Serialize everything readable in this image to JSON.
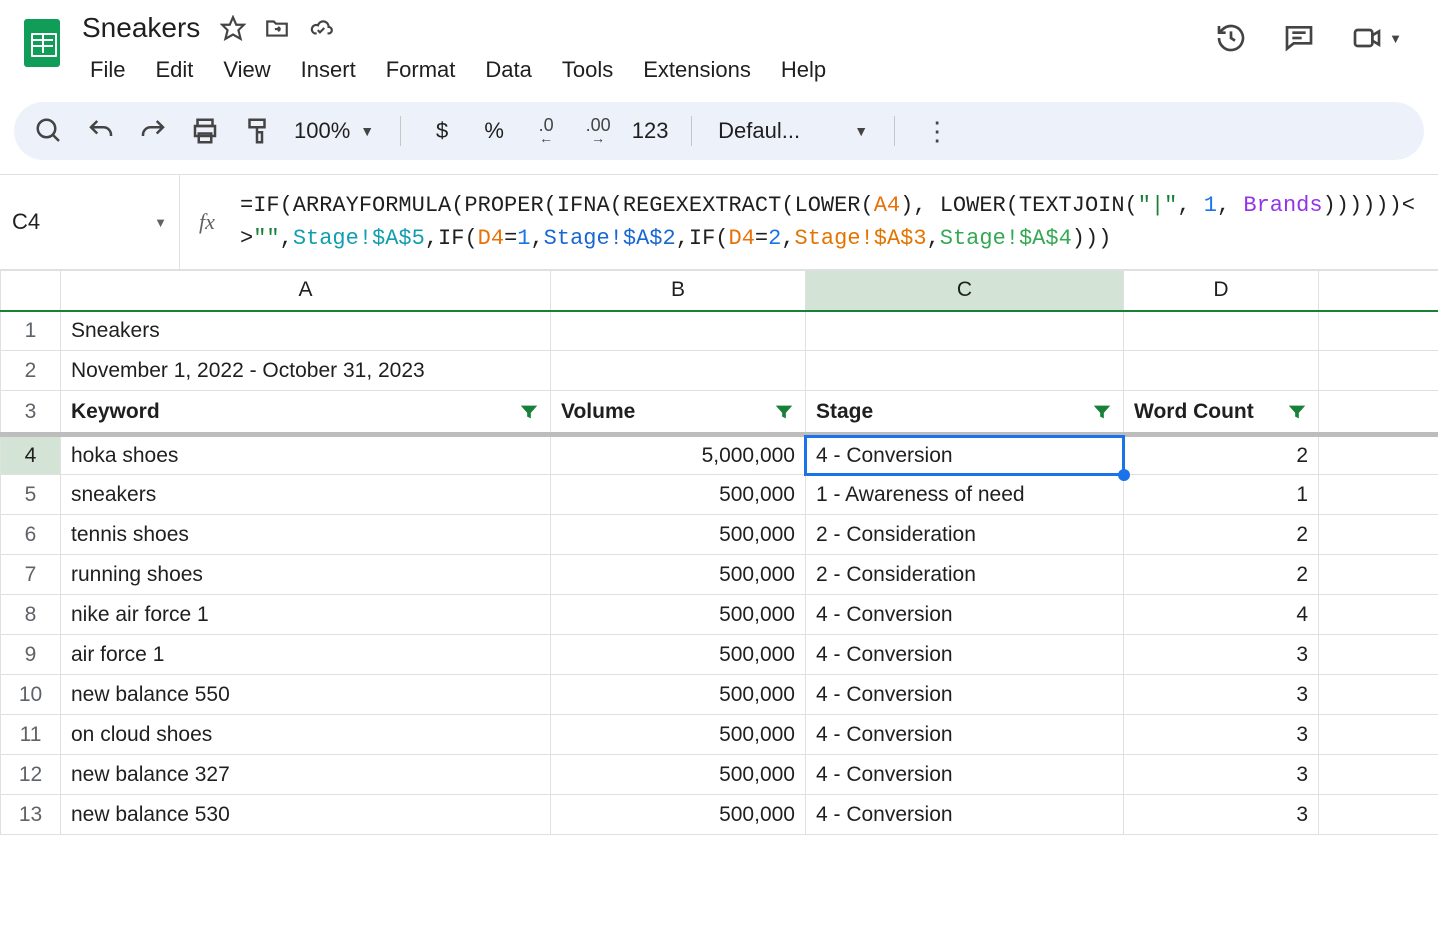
{
  "doc_title": "Sneakers",
  "menubar": [
    "File",
    "Edit",
    "View",
    "Insert",
    "Format",
    "Data",
    "Tools",
    "Extensions",
    "Help"
  ],
  "toolbar": {
    "zoom": "100%",
    "currency": "$",
    "percent": "%",
    "dec_decrease": ".0",
    "dec_increase": ".00",
    "number123": "123",
    "font": "Defaul..."
  },
  "active_cell": "C4",
  "formula": {
    "p1": "=IF(ARRAYFORMULA(PROPER(IFNA(REGEXEXTRACT(LOWER(",
    "a4": "A4",
    "p2": "), LOWER(TEXTJOIN(",
    "q1": "\"|\"",
    "p3": ", ",
    "one": "1",
    "p4": ", ",
    "brands": "Brands",
    "p5": "))))))<>",
    "q2": "\"\"",
    "p6": ",",
    "stageA5": "Stage!$A$5",
    "p7": ",IF(",
    "d4a": "D4",
    "eq1": "=",
    "n1": "1",
    "p8": ",",
    "stageA2": "Stage!$A$2",
    "p9": ",IF(",
    "d4b": "D4",
    "eq2": "=",
    "n2": "2",
    "p10": ",",
    "stageA3": "Stage!$A$3",
    "p11": ",",
    "stageA4": "Stage!$A$4",
    "p12": ")))"
  },
  "columns": [
    "A",
    "B",
    "C",
    "D"
  ],
  "row_numbers": [
    "1",
    "2",
    "3",
    "4",
    "5",
    "6",
    "7",
    "8",
    "9",
    "10",
    "11",
    "12",
    "13"
  ],
  "a1": "Sneakers",
  "a2": "November 1, 2022 - October 31, 2023",
  "headers": {
    "A": "Keyword",
    "B": "Volume",
    "C": "Stage",
    "D": "Word Count"
  },
  "rows": [
    {
      "keyword": "hoka shoes",
      "volume": "5,000,000",
      "stage": "4 - Conversion",
      "wc": "2"
    },
    {
      "keyword": "sneakers",
      "volume": "500,000",
      "stage": "1 - Awareness of need",
      "wc": "1"
    },
    {
      "keyword": "tennis shoes",
      "volume": "500,000",
      "stage": "2 - Consideration",
      "wc": "2"
    },
    {
      "keyword": "running shoes",
      "volume": "500,000",
      "stage": "2 - Consideration",
      "wc": "2"
    },
    {
      "keyword": "nike air force 1",
      "volume": "500,000",
      "stage": "4 - Conversion",
      "wc": "4"
    },
    {
      "keyword": "air force 1",
      "volume": "500,000",
      "stage": "4 - Conversion",
      "wc": "3"
    },
    {
      "keyword": "new balance 550",
      "volume": "500,000",
      "stage": "4 - Conversion",
      "wc": "3"
    },
    {
      "keyword": "on cloud shoes",
      "volume": "500,000",
      "stage": "4 - Conversion",
      "wc": "3"
    },
    {
      "keyword": "new balance 327",
      "volume": "500,000",
      "stage": "4 - Conversion",
      "wc": "3"
    },
    {
      "keyword": "new balance 530",
      "volume": "500,000",
      "stage": "4 - Conversion",
      "wc": "3"
    }
  ]
}
